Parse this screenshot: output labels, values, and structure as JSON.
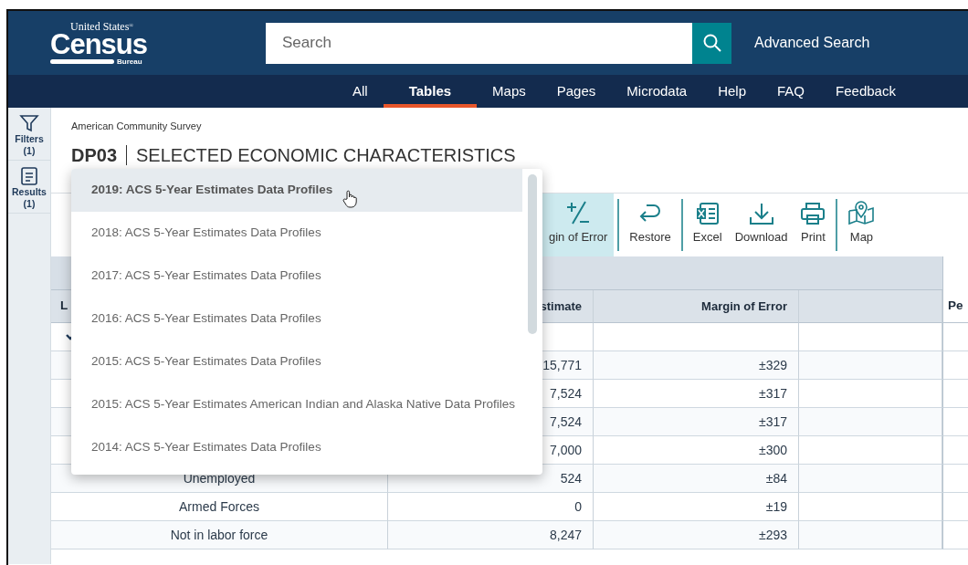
{
  "header": {
    "logo": {
      "top": "United States",
      "mark": "®",
      "main": "Census",
      "bottom": "Bureau"
    },
    "search": {
      "placeholder": "Search"
    },
    "advanced_search": "Advanced Search"
  },
  "nav": [
    {
      "label": "All",
      "selected": false
    },
    {
      "label": "Tables",
      "selected": true
    },
    {
      "label": "Maps",
      "selected": false
    },
    {
      "label": "Pages",
      "selected": false
    },
    {
      "label": "Microdata",
      "selected": false
    },
    {
      "label": "Help",
      "selected": false
    },
    {
      "label": "FAQ",
      "selected": false
    },
    {
      "label": "Feedback",
      "selected": false
    }
  ],
  "rail": [
    {
      "label": "Filters",
      "count": "(1)"
    },
    {
      "label": "Results",
      "count": "(1)"
    }
  ],
  "survey": "American Community Survey",
  "table_id": "DP03",
  "table_title": "SELECTED ECONOMIC CHARACTERISTICS",
  "toolbar": {
    "groups": [
      [
        {
          "label": "gin of Error",
          "active": true
        }
      ],
      [
        {
          "label": "Restore",
          "active": false
        }
      ],
      [
        {
          "label": "Excel",
          "active": false
        },
        {
          "label": "Download",
          "active": false
        },
        {
          "label": "Print",
          "active": false
        }
      ],
      [
        {
          "label": "Map",
          "active": false
        }
      ]
    ]
  },
  "table": {
    "columns": {
      "label": "L",
      "estimate": "stimate",
      "margin_of_error": "Margin of Error",
      "column_5": "Pe"
    },
    "rows": [
      {
        "kind": "group",
        "expanded": true
      },
      {
        "kind": "data",
        "estimate": "15,771",
        "margin_of_error": "±329"
      },
      {
        "kind": "data",
        "estimate": "7,524",
        "margin_of_error": "±317"
      },
      {
        "kind": "data",
        "estimate": "7,524",
        "margin_of_error": "±317"
      },
      {
        "kind": "data",
        "estimate": "7,000",
        "margin_of_error": "±300"
      },
      {
        "kind": "data",
        "label": "Unemployed",
        "estimate": "524",
        "margin_of_error": "±84"
      },
      {
        "kind": "data",
        "label": "Armed Forces",
        "estimate": "0",
        "margin_of_error": "±19"
      },
      {
        "kind": "data",
        "label": "Not in labor force",
        "estimate": "8,247",
        "margin_of_error": "±293"
      }
    ]
  },
  "dropdown": {
    "items": [
      {
        "label": "2019: ACS 5-Year Estimates Data Profiles",
        "selected": true
      },
      {
        "label": "2018: ACS 5-Year Estimates Data Profiles",
        "selected": false
      },
      {
        "label": "2017: ACS 5-Year Estimates Data Profiles",
        "selected": false
      },
      {
        "label": "2016: ACS 5-Year Estimates Data Profiles",
        "selected": false
      },
      {
        "label": "2015: ACS 5-Year Estimates Data Profiles",
        "selected": false
      },
      {
        "label": "2015: ACS 5-Year Estimates American Indian and Alaska Native Data Profiles",
        "selected": false
      },
      {
        "label": "2014: ACS 5-Year Estimates Data Profiles",
        "selected": false
      }
    ]
  }
}
